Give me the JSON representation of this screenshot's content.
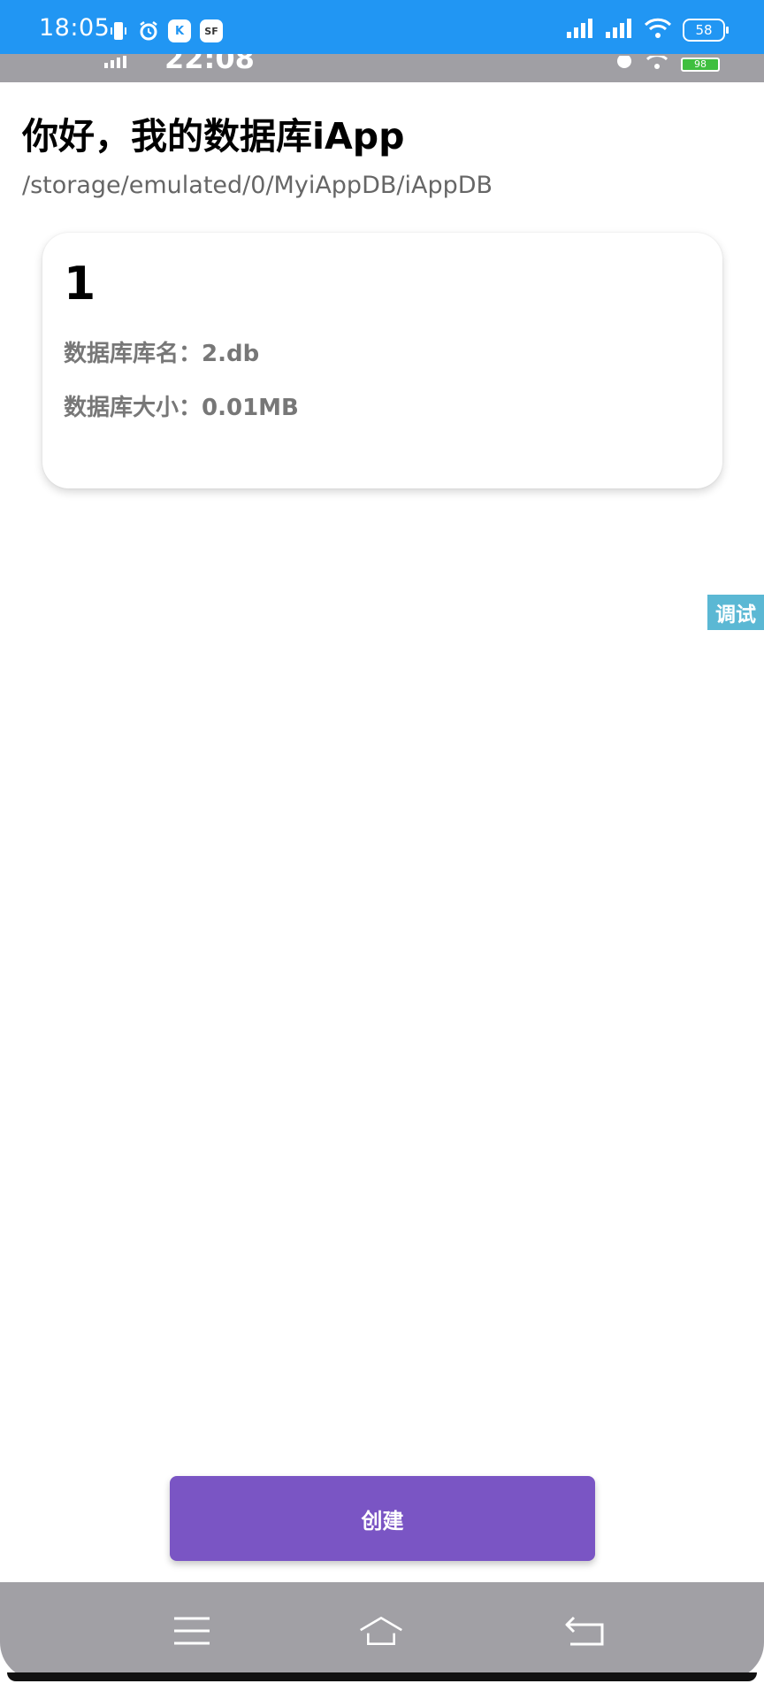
{
  "status_bar": {
    "time": "18:05",
    "battery": "58",
    "icons": [
      "phone-vibrate-icon",
      "alarm-icon",
      "k-app-icon",
      "sf-app-icon",
      "signal-icon",
      "signal-icon",
      "wifi-icon",
      "battery-icon"
    ],
    "badge_k": "K",
    "badge_sf": "SF"
  },
  "inner_status_bar": {
    "time_fragment": "22:08",
    "battery_fragment": "98"
  },
  "header": {
    "title": "你好，我的数据库iApp",
    "path": "/storage/emulated/0/MyiAppDB/iAppDB"
  },
  "databases": [
    {
      "index": "1",
      "name_label": "数据库库名：",
      "name_value": "2.db",
      "size_label": "数据库大小：",
      "size_value": "0.01MB"
    }
  ],
  "debug_tab": {
    "label": "调试"
  },
  "actions": {
    "create_label": "创建"
  },
  "nav_bar": {
    "icons": [
      "menu-icon",
      "home-icon",
      "back-icon"
    ]
  },
  "colors": {
    "status_bar": "#2196f3",
    "accent_button": "#7a55c4",
    "debug_tab": "#5bb8d4",
    "nav_bar": "#a1a0a5"
  }
}
